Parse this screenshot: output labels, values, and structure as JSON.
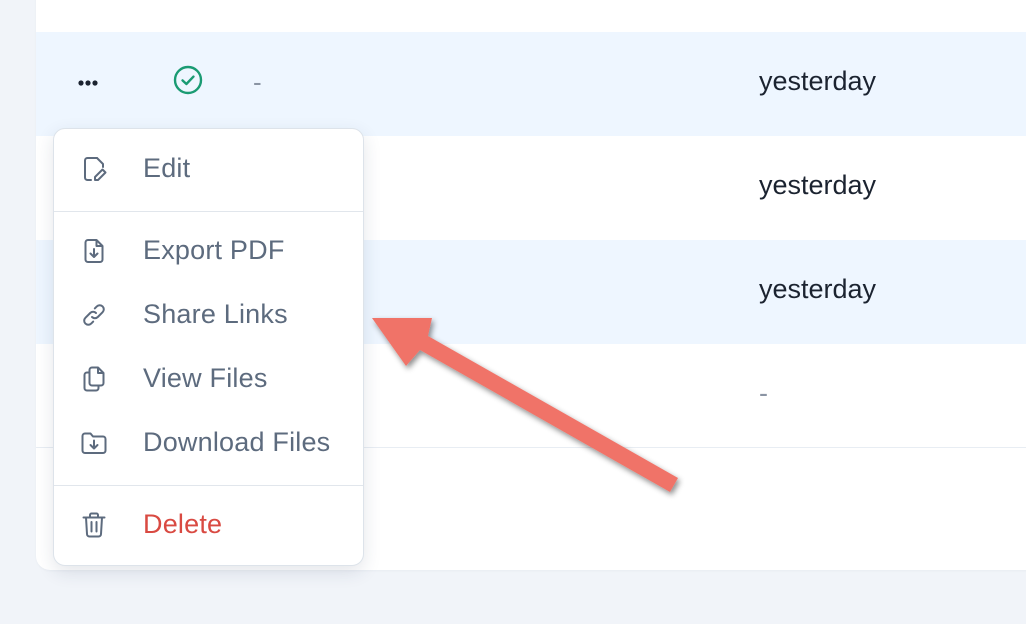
{
  "table": {
    "rows": [
      {
        "more_label": "•••",
        "status": "complete",
        "dash": "-",
        "date": "yesterday"
      },
      {
        "date": "yesterday"
      },
      {
        "date": "yesterday"
      },
      {
        "date": "-"
      }
    ]
  },
  "menu": {
    "items": [
      {
        "label": "Edit",
        "icon": "edit-document-icon"
      },
      {
        "label": "Export PDF",
        "icon": "file-download-icon"
      },
      {
        "label": "Share Links",
        "icon": "link-icon"
      },
      {
        "label": "View Files",
        "icon": "files-icon"
      },
      {
        "label": "Download Files",
        "icon": "folder-download-icon"
      },
      {
        "label": "Delete",
        "icon": "trash-icon"
      }
    ]
  },
  "colors": {
    "row_highlight": "#eef6ff",
    "status_green": "#1a9b73",
    "menu_text": "#5d6b7e",
    "danger": "#d94a42",
    "annotation_arrow": "#f07368"
  }
}
